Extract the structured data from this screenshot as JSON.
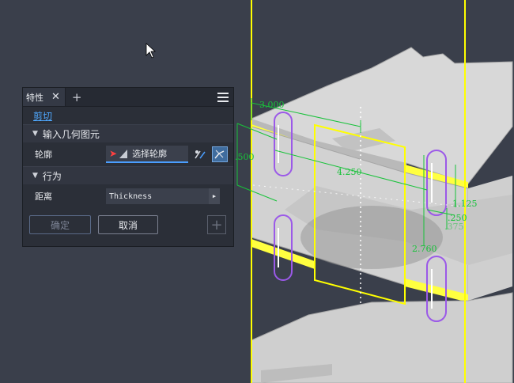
{
  "panel": {
    "tab_label": "特性",
    "tab_close": "✕",
    "tab_add": "+",
    "subtitle": "剪切",
    "section_input": "输入几何图元",
    "profile_label": "轮廓",
    "profile_value": "选择轮廓",
    "section_behavior": "行为",
    "distance_label": "距离",
    "distance_value": "Thickness",
    "ok_label": "确定",
    "cancel_label": "取消",
    "plus_label": "+"
  },
  "viewport": {
    "dimensions": [
      "3.000",
      "4.250",
      ".500",
      "1.125",
      ".250",
      ".375",
      "2.760"
    ]
  },
  "colors": {
    "background": "#3a3f4b",
    "sketch": "#ffff00",
    "dimension": "#18c23a",
    "slot": "#9b59e8"
  }
}
